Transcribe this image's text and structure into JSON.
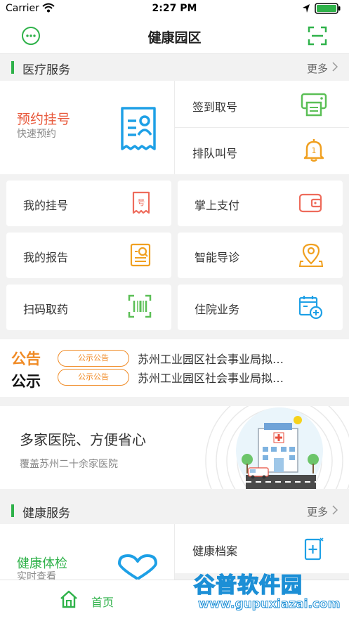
{
  "status_bar": {
    "carrier": "Carrier",
    "time": "2:27 PM"
  },
  "nav": {
    "title": "健康园区"
  },
  "medical": {
    "header": "医疗服务",
    "more": "更多",
    "appointment": {
      "title": "预约挂号",
      "subtitle": "快速预约"
    },
    "checkin": "签到取号",
    "queue": "排队叫号",
    "grid": [
      {
        "label": "我的挂号",
        "icon": "registration-slip-icon"
      },
      {
        "label": "掌上支付",
        "icon": "wallet-icon"
      },
      {
        "label": "我的报告",
        "icon": "report-search-icon"
      },
      {
        "label": "智能导诊",
        "icon": "location-pin-icon"
      },
      {
        "label": "扫码取药",
        "icon": "barcode-scan-icon"
      },
      {
        "label": "住院业务",
        "icon": "hospital-calendar-icon"
      }
    ]
  },
  "notice": {
    "label_line1": "公告",
    "label_line2": "公示",
    "items": [
      {
        "tag": "公示公告",
        "text": "苏州工业园区社会事业局拟…"
      },
      {
        "tag": "公示公告",
        "text": "苏州工业园区社会事业局拟…"
      }
    ]
  },
  "banner": {
    "title": "多家医院、方便省心",
    "subtitle": "覆盖苏州二十余家医院"
  },
  "health": {
    "header": "健康服务",
    "more": "更多",
    "checkup": {
      "title": "健康体检",
      "subtitle": "实时查看"
    },
    "records": "健康档案"
  },
  "tabbar": {
    "home": "首页"
  },
  "watermark": {
    "line1": "谷普软件园",
    "line2": "www.gupuxiazai.com"
  },
  "colors": {
    "accent_green": "#2fb24a",
    "appointment_red": "#e8593c",
    "notice_orange": "#f08a24",
    "icon_blue": "#1ea0e6"
  }
}
